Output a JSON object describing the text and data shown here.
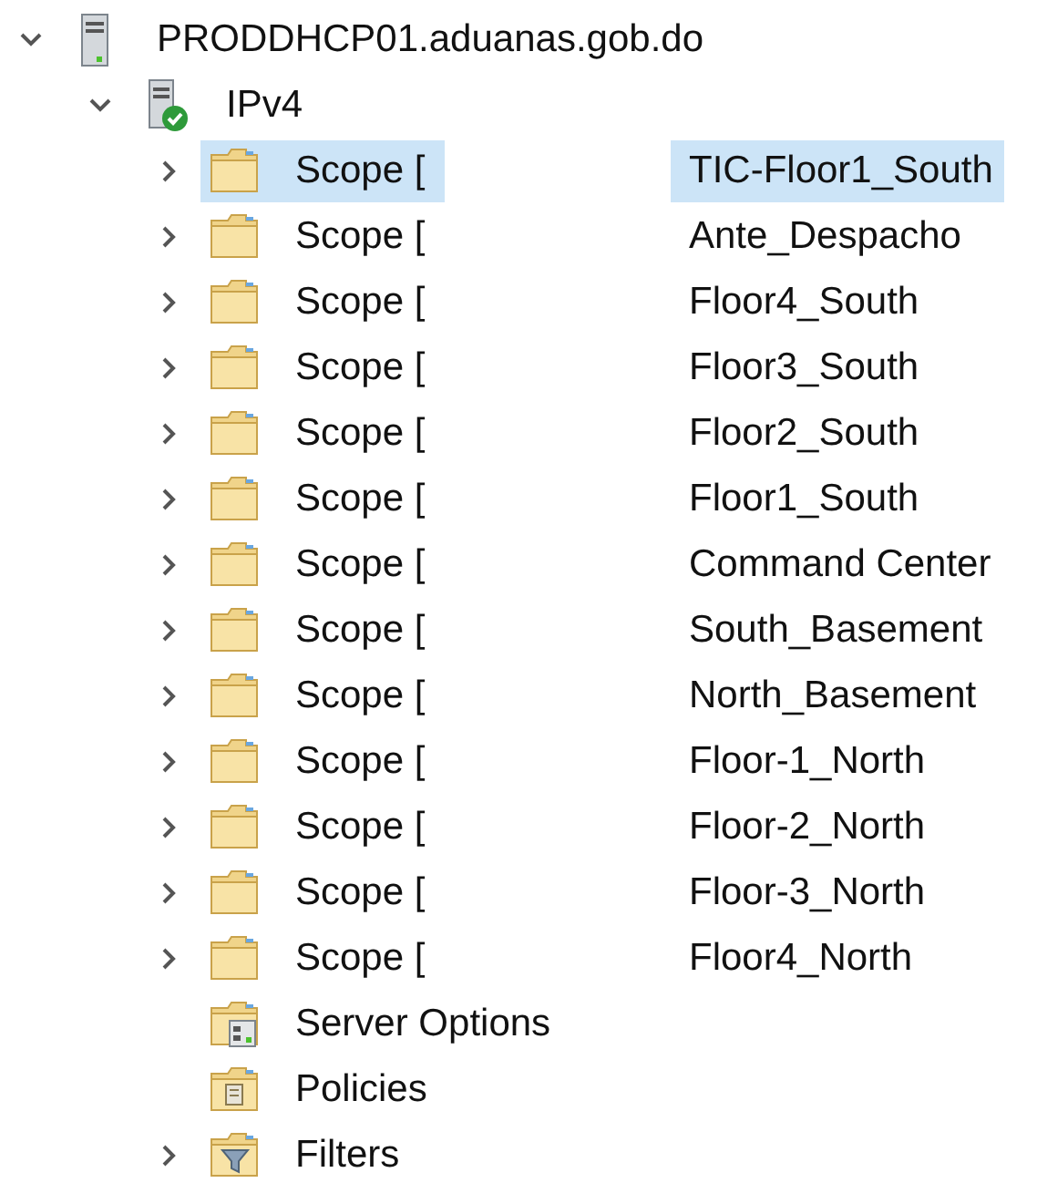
{
  "tree": [
    {
      "kind": "server",
      "label": "PRODDHCP01.aduanas.gob.do",
      "expanded": true,
      "selected": false,
      "children": [
        {
          "kind": "ipv4",
          "label": "IPv4",
          "expanded": true,
          "selected": false,
          "children": [
            {
              "kind": "scope",
              "label": "Scope [",
              "name": "TIC-Floor1_South",
              "expanded": false,
              "selected": true
            },
            {
              "kind": "scope",
              "label": "Scope [",
              "name": "Ante_Despacho",
              "expanded": false,
              "selected": false
            },
            {
              "kind": "scope",
              "label": "Scope [",
              "name": "Floor4_South",
              "expanded": false,
              "selected": false
            },
            {
              "kind": "scope",
              "label": "Scope [",
              "name": "Floor3_South",
              "expanded": false,
              "selected": false
            },
            {
              "kind": "scope",
              "label": "Scope [",
              "name": "Floor2_South",
              "expanded": false,
              "selected": false
            },
            {
              "kind": "scope",
              "label": "Scope [",
              "name": "Floor1_South",
              "expanded": false,
              "selected": false
            },
            {
              "kind": "scope",
              "label": "Scope [",
              "name": "Command Center",
              "expanded": false,
              "selected": false
            },
            {
              "kind": "scope",
              "label": "Scope [",
              "name": "South_Basement",
              "expanded": false,
              "selected": false
            },
            {
              "kind": "scope",
              "label": "Scope [",
              "name": "North_Basement",
              "expanded": false,
              "selected": false
            },
            {
              "kind": "scope",
              "label": "Scope [",
              "name": "Floor-1_North",
              "expanded": false,
              "selected": false
            },
            {
              "kind": "scope",
              "label": "Scope [",
              "name": "Floor-2_North",
              "expanded": false,
              "selected": false
            },
            {
              "kind": "scope",
              "label": "Scope [",
              "name": "Floor-3_North",
              "expanded": false,
              "selected": false
            },
            {
              "kind": "scope",
              "label": "Scope [",
              "name": "Floor4_North",
              "expanded": false,
              "selected": false
            },
            {
              "kind": "server-options",
              "label": "Server Options",
              "selected": false
            },
            {
              "kind": "policies",
              "label": "Policies",
              "selected": false
            },
            {
              "kind": "filters",
              "label": "Filters",
              "expanded": false,
              "selected": false
            }
          ]
        }
      ]
    }
  ]
}
